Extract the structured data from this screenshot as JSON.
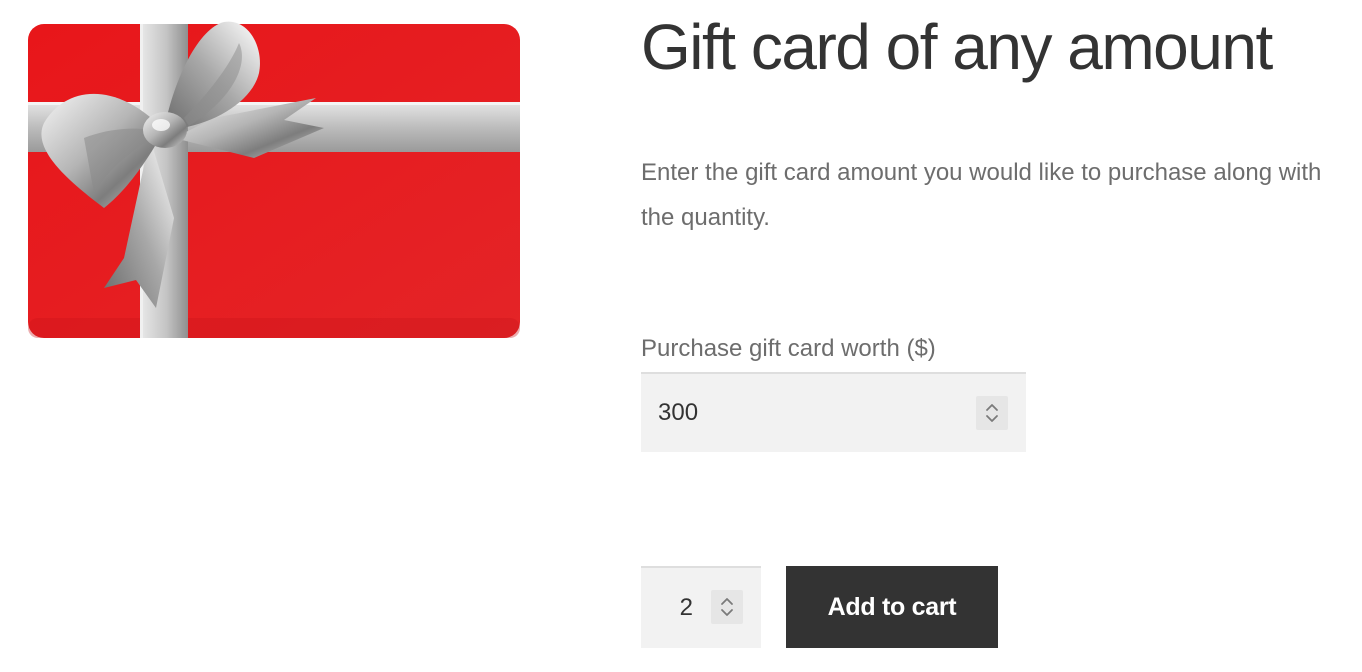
{
  "product": {
    "title": "Gift card of any amount",
    "description": "Enter the gift card amount you would like to purchase along with the quantity.",
    "image_icon": "gift-card-with-silver-bow",
    "colors": {
      "card_red": "#e31e24",
      "ribbon_silver": "#c9c9c9",
      "button_bg": "#333333"
    }
  },
  "amount": {
    "label": "Purchase gift card worth ($)",
    "value": "300"
  },
  "quantity": {
    "value": "2"
  },
  "cart": {
    "button_label": "Add to cart"
  },
  "icons": {
    "spinner": "up-down-chevron-icon"
  }
}
